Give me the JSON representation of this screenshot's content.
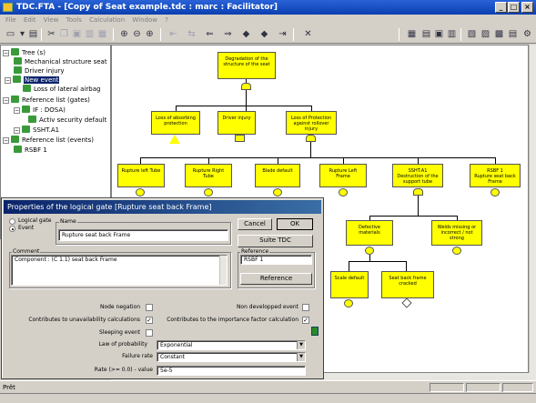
{
  "window": {
    "title": "TDC.FTA - [Copy of Seat example.tdc : marc : Facilitator]"
  },
  "menu": [
    "File",
    "Edit",
    "View",
    "Tools",
    "Calculation",
    "Window",
    "?"
  ],
  "tree": {
    "items": [
      {
        "label": "Tree (s)",
        "depth": 0
      },
      {
        "label": "Mechanical structure seat",
        "depth": 1
      },
      {
        "label": "Driver injury",
        "depth": 1
      },
      {
        "label": "New event",
        "depth": 1,
        "selected": true
      },
      {
        "label": "Loss of lateral airbag",
        "depth": 2
      },
      {
        "label": "Reference list (gates)",
        "depth": 0
      },
      {
        "label": "IF : DOSA)",
        "depth": 1
      },
      {
        "label": "Activ security default",
        "depth": 2
      },
      {
        "label": "SSHT.A1",
        "depth": 1
      },
      {
        "label": "Reference list (events)",
        "depth": 0
      },
      {
        "label": "RSBF 1",
        "depth": 1
      }
    ]
  },
  "diagram": {
    "top_gate": "Degradation of the structure of the seat",
    "level2": [
      "Loss of absorbing protection",
      "Driver injury",
      "Loss of Protection against rollover injury"
    ],
    "level3": [
      "Rupture left Tube",
      "Rupture Right Tube",
      "Blade default",
      "Rupture Left Frame",
      "Destruction of the support tube",
      "Rupture seat back Frame"
    ],
    "level3_ids": [
      "",
      "",
      "",
      "",
      "SSHT.A1",
      "RSBF 1"
    ],
    "level4": [
      "Defective materials",
      "Welds missing or incorrect / not strong",
      "Scale default",
      "Seat back frame cracked"
    ]
  },
  "dialog": {
    "title": "Properties of the logical gate [Rupture seat back Frame]",
    "type_options": [
      "Logical gate",
      "Event"
    ],
    "selected_type": "Event",
    "name_label": "Name",
    "name_value": "Rupture seat back Frame",
    "comment_label": "Comment",
    "comment_value": "Component : (C 1.1)  seat back Frame",
    "reference_label": "Reference",
    "reference_value": "RSBF 1",
    "buttons": {
      "cancel": "Cancel",
      "ok": "OK",
      "suite": "Suite TDC",
      "reference": "Reference"
    },
    "checks": [
      {
        "label": "Node negation",
        "checked": false
      },
      {
        "label": "Contributes to unavailability calculations",
        "checked": true
      },
      {
        "label": "Sleeping event",
        "checked": false
      },
      {
        "label": "Non developped event",
        "checked": false
      },
      {
        "label": "Contributes to the importance factor calculation",
        "checked": true
      }
    ],
    "law_label": "Law of probability",
    "law_value": "Exponential",
    "failure_label": "Failure rate",
    "failure_value": "Constant",
    "rate_label": "Rate (>= 0.0) - value",
    "rate_value": "5e-5"
  },
  "status": {
    "text": "Prêt"
  }
}
